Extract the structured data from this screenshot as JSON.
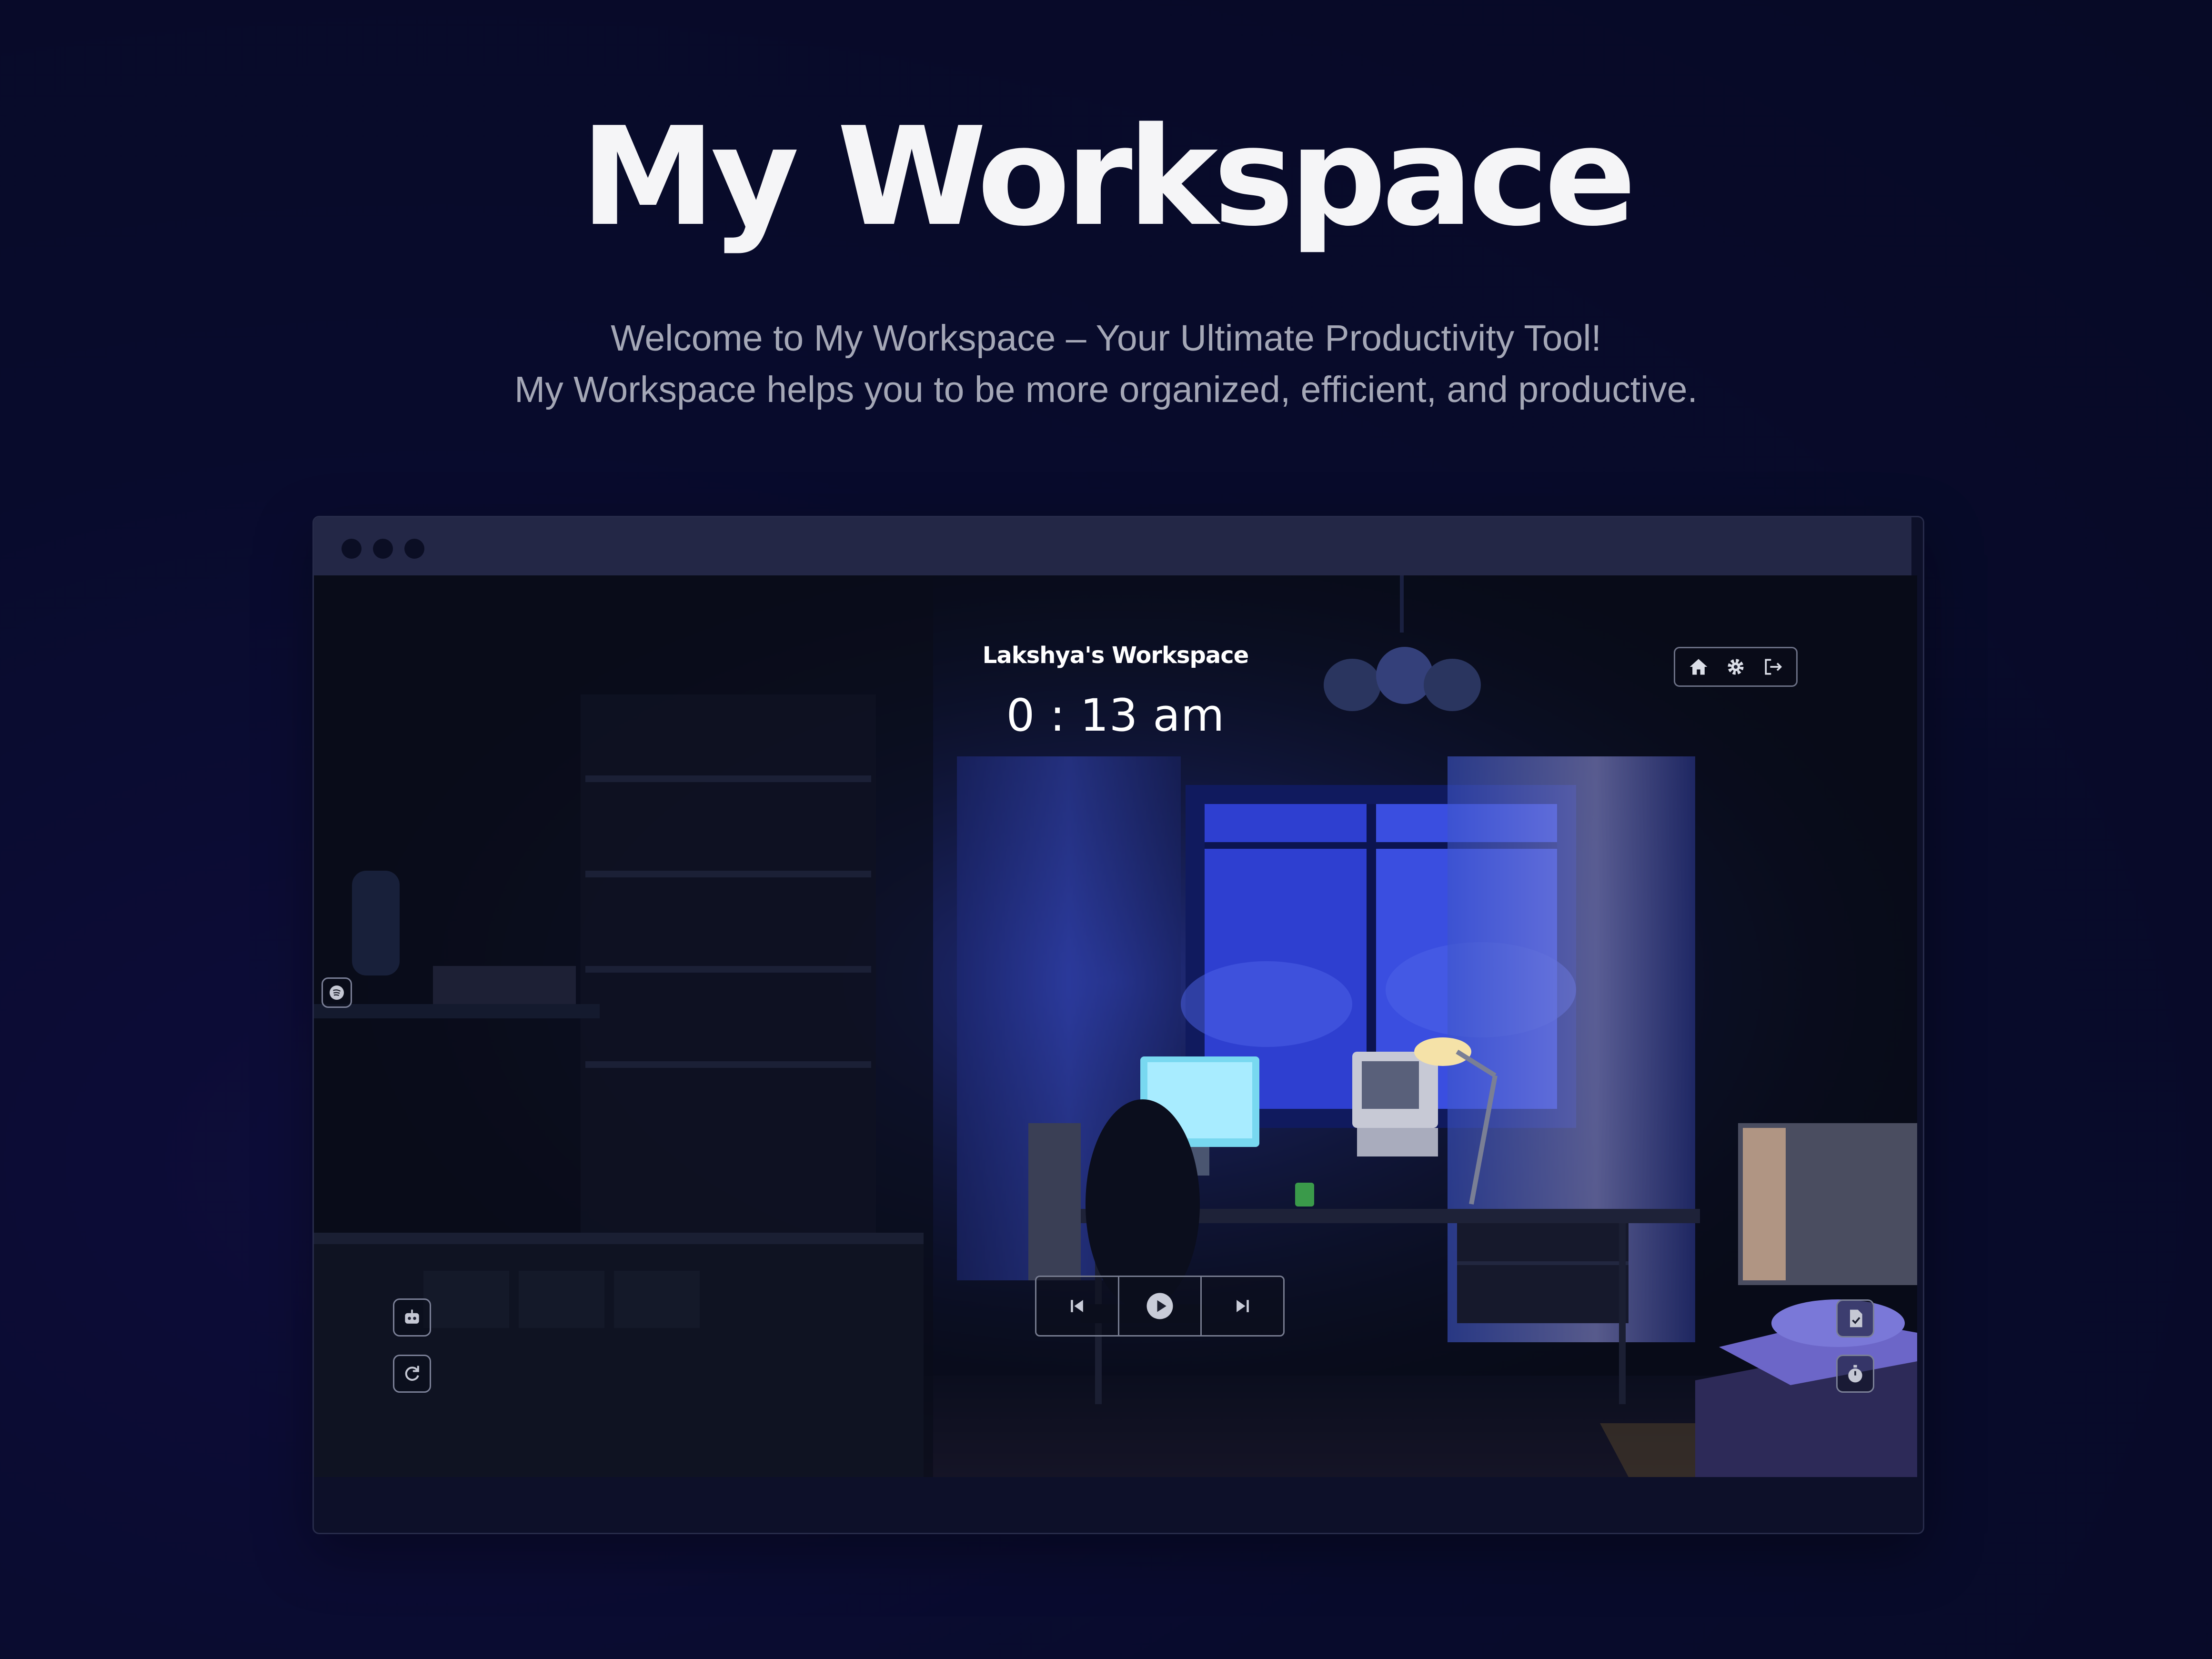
{
  "hero": {
    "title": "My Workspace",
    "subtitle_line1": "Welcome to My Workspace – Your Ultimate Productivity Tool!",
    "subtitle_line2": "My Workspace helps you to be more organized, efficient, and productive."
  },
  "app": {
    "workspace_title": "Lakshya's Workspace",
    "clock": "0 : 13 am",
    "nav_icons": [
      "home-icon",
      "gear-icon",
      "logout-icon"
    ],
    "left_icons": [
      "spotify-icon",
      "robot-icon",
      "refresh-icon"
    ],
    "right_icons": [
      "notes-icon",
      "stopwatch-icon"
    ],
    "player_icons": [
      "skip-previous-icon",
      "play-icon",
      "skip-next-icon"
    ]
  },
  "colors": {
    "page_background": "#080b2c",
    "titlebar": "#232746",
    "window_light": "#3b4fd8",
    "text_primary": "#f5f5f7",
    "text_secondary": "#a4a7b6"
  }
}
